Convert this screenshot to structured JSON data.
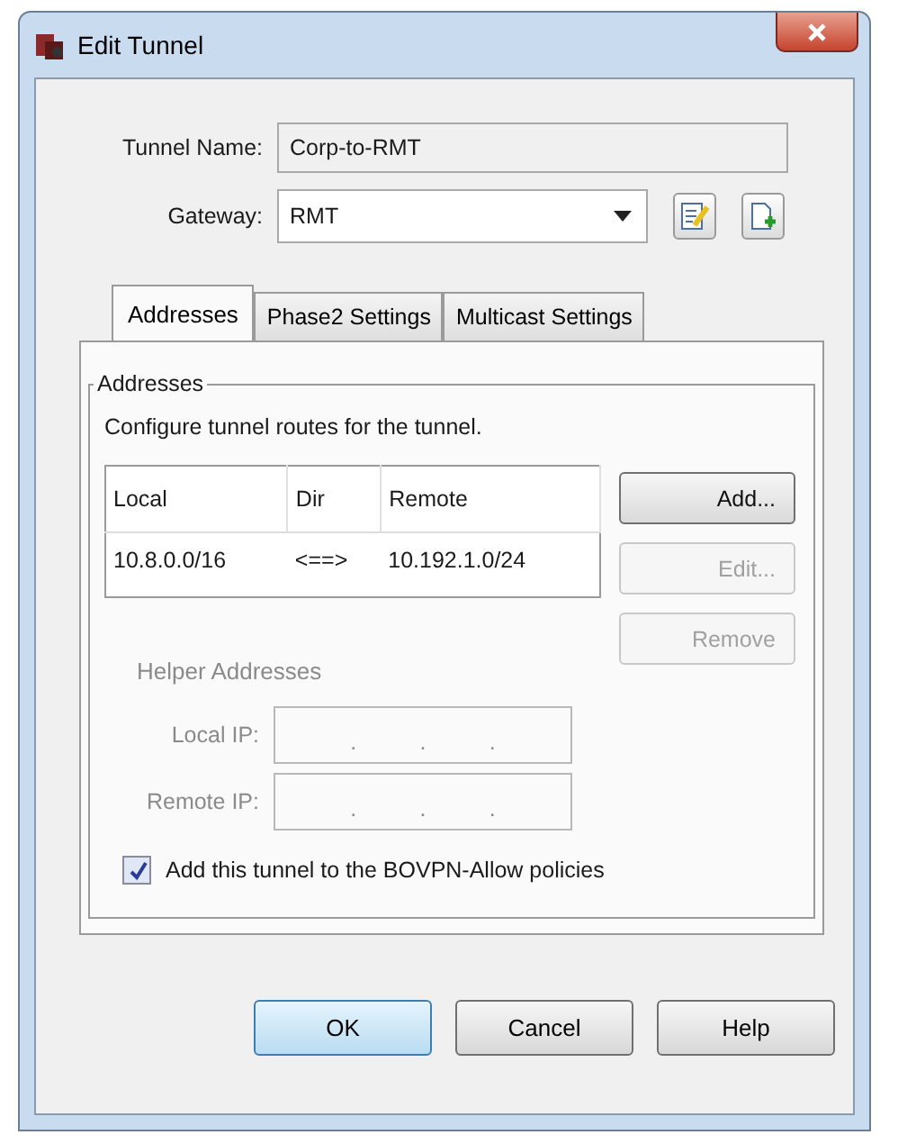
{
  "window": {
    "title": "Edit Tunnel"
  },
  "fields": [
    {
      "label": "Tunnel Name:",
      "value": "Corp-to-RMT",
      "kind": "text"
    },
    {
      "label": "Gateway:",
      "value": "RMT",
      "kind": "combo"
    }
  ],
  "tabs": [
    {
      "label": "Addresses",
      "selected": true
    },
    {
      "label": "Phase2 Settings",
      "selected": false
    },
    {
      "label": "Multicast Settings",
      "selected": false
    }
  ],
  "group": {
    "title": "Addresses",
    "description": "Configure tunnel routes for the tunnel.",
    "table": {
      "columns": [
        "Local",
        "Dir",
        "Remote"
      ],
      "rows": [
        [
          "10.8.0.0/16",
          "<==>",
          "10.192.1.0/24"
        ]
      ]
    },
    "buttons": [
      {
        "label": "Add...",
        "disabled": false
      },
      {
        "label": "Edit...",
        "disabled": true
      },
      {
        "label": "Remove",
        "disabled": true
      }
    ],
    "helper": {
      "title": "Helper Addresses",
      "disabled": true,
      "fields": [
        {
          "label": "Local IP:",
          "separators": [
            ".",
            ".",
            "."
          ]
        },
        {
          "label": "Remote IP:",
          "separators": [
            ".",
            ".",
            "."
          ]
        }
      ]
    },
    "checkbox": {
      "label": "Add this tunnel to the BOVPN-Allow policies",
      "checked": true
    }
  },
  "buttons": [
    {
      "label": "OK",
      "default": true
    },
    {
      "label": "Cancel",
      "default": false
    },
    {
      "label": "Help",
      "default": false
    }
  ]
}
